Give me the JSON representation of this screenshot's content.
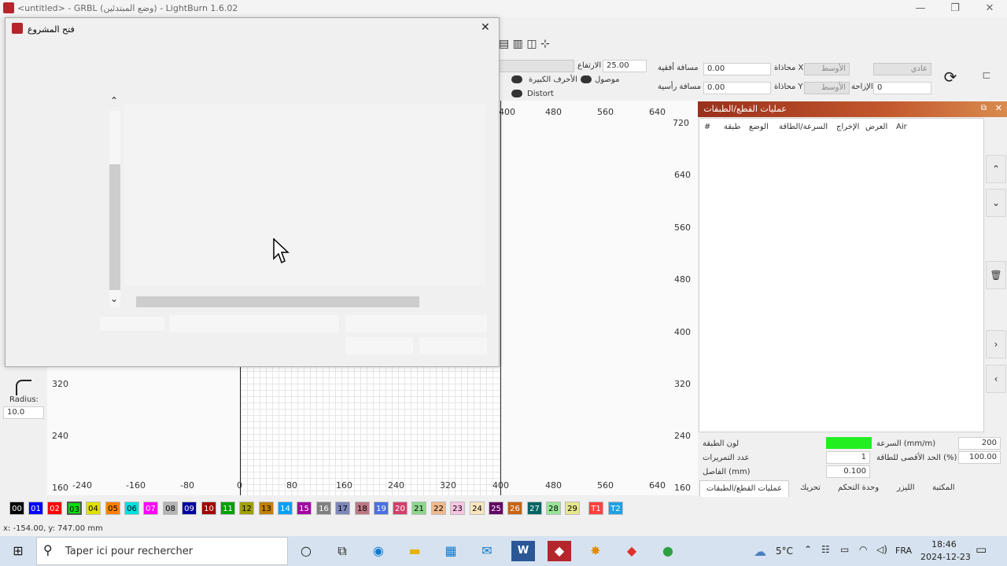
{
  "window": {
    "title": "<untitled> - GRBL (وضع المبتدئين) - LightBurn 1.6.02",
    "min": "—",
    "max": "❐",
    "close": "✕"
  },
  "toolbar": {
    "height_label": "الارتفاع",
    "height_value": "25.00",
    "h_distance_label": "مسافة أفقية",
    "h_distance_value": "0.00",
    "v_distance_label": "مسافة رأسية",
    "v_distance_value": "0.00",
    "align_x_label": "محاذاة X",
    "align_x_value": "الأوسط",
    "align_y_label": "محاذاة Y",
    "align_y_value": "الأوسط",
    "mode_value": "عادي",
    "offset_label": "الإزاحة",
    "offset_value": "0",
    "caps_label": "الأحرف الكبيرة",
    "connected_label": "موصول",
    "distort_label": "Distort"
  },
  "dialog": {
    "title": "فتح المشروع",
    "close": "✕",
    "scroll_up": "⌃",
    "scroll_down": "⌄"
  },
  "canvas": {
    "x_ticks": [
      "-240",
      "-160",
      "-80",
      "0",
      "80",
      "160",
      "240",
      "320",
      "400",
      "480",
      "560",
      "640"
    ],
    "top_ticks": [
      "400",
      "480",
      "560",
      "640"
    ],
    "y_ticks": [
      "720",
      "640",
      "560",
      "480",
      "400",
      "320",
      "240",
      "160"
    ],
    "left_y_ticks": [
      "320",
      "240",
      "160"
    ]
  },
  "left_tools": {
    "radius_label": "Radius:",
    "radius_value": "10.0"
  },
  "panel": {
    "title": "عمليات القطع/الطبقات",
    "columns": [
      "#",
      "طبقة",
      "الوضع",
      "السرعة/الطاقة",
      "الإخراج",
      "العرض",
      "Air"
    ],
    "layer_color_label": "لون الطبقة",
    "layer_color": "#22ee22",
    "speed_label": "السرعة (mm/m)",
    "speed_value": "200",
    "passes_label": "عدد التمريرات",
    "passes_value": "1",
    "max_power_label": "الحد الأقصى للطاقة (%)",
    "max_power_value": "100.00",
    "interval_label": "الفاصل (mm)",
    "interval_value": "0.100",
    "tabs": [
      "المكتبة",
      "الليزر",
      "وحدة التحكم",
      "تحريك",
      "عمليات القطع/الطبقات"
    ]
  },
  "palette": [
    {
      "label": "00",
      "color": "#000000",
      "text": "#ffffff"
    },
    {
      "label": "01",
      "color": "#0000ff",
      "text": "#ffffff"
    },
    {
      "label": "02",
      "color": "#ff0000",
      "text": "#ffffff"
    },
    {
      "label": "03",
      "color": "#00e000",
      "text": "#000000"
    },
    {
      "label": "04",
      "color": "#e0e000",
      "text": "#000000"
    },
    {
      "label": "05",
      "color": "#ff8000",
      "text": "#000000"
    },
    {
      "label": "06",
      "color": "#00e0e0",
      "text": "#000000"
    },
    {
      "label": "07",
      "color": "#ff00ff",
      "text": "#ffffff"
    },
    {
      "label": "08",
      "color": "#b4b4b4",
      "text": "#000000"
    },
    {
      "label": "09",
      "color": "#0000a0",
      "text": "#ffffff"
    },
    {
      "label": "10",
      "color": "#a00000",
      "text": "#ffffff"
    },
    {
      "label": "11",
      "color": "#00a000",
      "text": "#ffffff"
    },
    {
      "label": "12",
      "color": "#a0a000",
      "text": "#000000"
    },
    {
      "label": "13",
      "color": "#c08000",
      "text": "#000000"
    },
    {
      "label": "14",
      "color": "#00a0ff",
      "text": "#ffffff"
    },
    {
      "label": "15",
      "color": "#a000a0",
      "text": "#ffffff"
    },
    {
      "label": "16",
      "color": "#808080",
      "text": "#ffffff"
    },
    {
      "label": "17",
      "color": "#7d87b9",
      "text": "#000000"
    },
    {
      "label": "18",
      "color": "#bb7784",
      "text": "#000000"
    },
    {
      "label": "19",
      "color": "#4a6fe3",
      "text": "#ffffff"
    },
    {
      "label": "20",
      "color": "#d33f6a",
      "text": "#ffffff"
    },
    {
      "label": "21",
      "color": "#8cd78c",
      "text": "#000000"
    },
    {
      "label": "22",
      "color": "#f0b98d",
      "text": "#000000"
    },
    {
      "label": "23",
      "color": "#f6c4e1",
      "text": "#000000"
    },
    {
      "label": "24",
      "color": "#fae6be",
      "text": "#000000"
    },
    {
      "label": "25",
      "color": "#640064",
      "text": "#ffffff"
    },
    {
      "label": "26",
      "color": "#c86414",
      "text": "#ffffff"
    },
    {
      "label": "27",
      "color": "#006464",
      "text": "#ffffff"
    },
    {
      "label": "28",
      "color": "#96e696",
      "text": "#000000"
    },
    {
      "label": "29",
      "color": "#e6e68c",
      "text": "#000000"
    },
    {
      "label": "T1",
      "color": "#ff4040",
      "text": "#ffffff"
    },
    {
      "label": "T2",
      "color": "#20a0e0",
      "text": "#ffffff"
    }
  ],
  "status": {
    "coords": "x: -154.00, y: 747.00 mm"
  },
  "taskbar": {
    "search_placeholder": "Taper ici pour rechercher",
    "weather": "5°C",
    "lang": "FRA",
    "time": "18:46",
    "date": "2024-12-23"
  }
}
